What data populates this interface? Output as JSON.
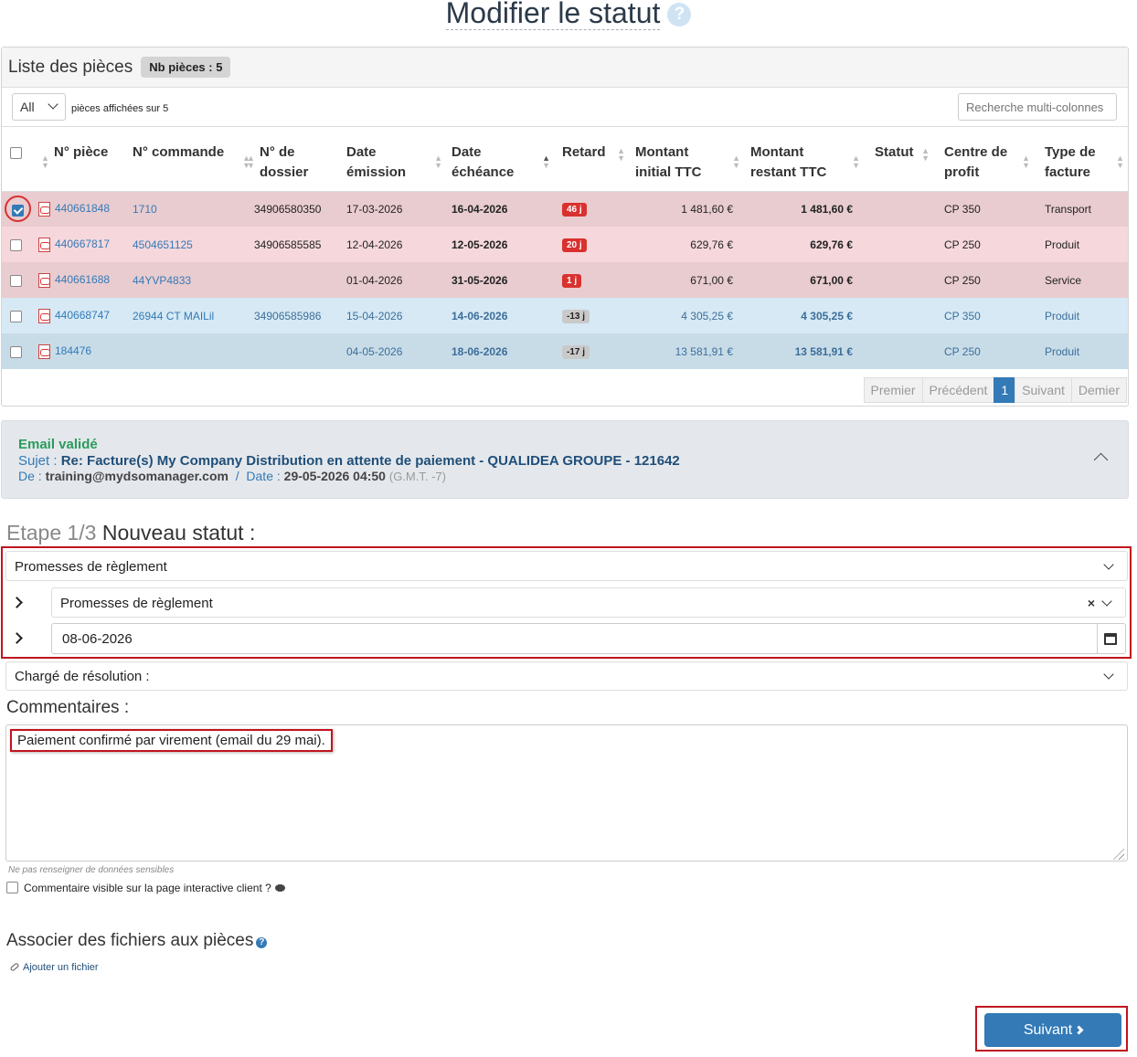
{
  "page": {
    "title": "Modifier le statut",
    "help_glyph": "?"
  },
  "panel": {
    "title": "Liste des pièces",
    "count_badge": "Nb pièces : 5",
    "page_size": "All",
    "shown_text": "pièces affichées sur 5",
    "search_placeholder": "Recherche multi-colonnes"
  },
  "columns": [
    "N° pièce",
    "N° commande",
    "N° de dossier",
    "Date émission",
    "Date échéance",
    "Retard",
    "Montant initial TTC",
    "Montant restant TTC",
    "Statut",
    "Centre de profit",
    "Type de facture"
  ],
  "rows": [
    {
      "piece": "440661848",
      "commande": "1710",
      "dossier": "34906580350",
      "emission": "17-03-2026",
      "echeance": "16-04-2026",
      "retard": "46 j",
      "retard_kind": "red",
      "initial": "1 481,60 €",
      "restant": "1 481,60 €",
      "statut": "",
      "centre": "CP 350",
      "type": "Transport",
      "checked": true
    },
    {
      "piece": "440667817",
      "commande": "4504651125",
      "dossier": "34906585585",
      "emission": "12-04-2026",
      "echeance": "12-05-2026",
      "retard": "20 j",
      "retard_kind": "red",
      "initial": "629,76 €",
      "restant": "629,76 €",
      "statut": "",
      "centre": "CP 250",
      "type": "Produit",
      "checked": false
    },
    {
      "piece": "440661688",
      "commande": "44YVP4833",
      "dossier": "",
      "emission": "01-04-2026",
      "echeance": "31-05-2026",
      "retard": "1 j",
      "retard_kind": "red",
      "initial": "671,00 €",
      "restant": "671,00 €",
      "statut": "",
      "centre": "CP 250",
      "type": "Service",
      "checked": false
    },
    {
      "piece": "440668747",
      "commande": "26944 CT MAILil",
      "dossier": "34906585986",
      "emission": "15-04-2026",
      "echeance": "14-06-2026",
      "retard": "-13 j",
      "retard_kind": "grey",
      "initial": "4 305,25 €",
      "restant": "4 305,25 €",
      "statut": "",
      "centre": "CP 350",
      "type": "Produit",
      "checked": false
    },
    {
      "piece": "184476",
      "commande": "",
      "dossier": "",
      "emission": "04-05-2026",
      "echeance": "18-06-2026",
      "retard": "-17 j",
      "retard_kind": "grey",
      "initial": "13 581,91 €",
      "restant": "13 581,91 €",
      "statut": "",
      "centre": "CP 250",
      "type": "Produit",
      "checked": false
    }
  ],
  "pager": {
    "first": "Premier",
    "prev": "Précédent",
    "current": "1",
    "next": "Suivant",
    "last": "Demier"
  },
  "email": {
    "status": "Email validé",
    "subject_label": "Sujet :",
    "subject": "Re: Facture(s) My Company Distribution en attente de paiement - QUALIDEA GROUPE - 121642",
    "from_label": "De :",
    "from": "training@mydsomanager.com",
    "sep": "/",
    "date_label": "Date :",
    "date": "29-05-2026 04:50",
    "tz": "(G.M.T. -7)"
  },
  "step": {
    "number": "Etape 1/3",
    "title": "Nouveau statut :"
  },
  "status_form": {
    "status": "Promesses de règlement",
    "sub_status": "Promesses de règlement",
    "date": "08-06-2026",
    "owner": "Chargé de résolution :"
  },
  "comments": {
    "label": "Commentaires :",
    "text": "Paiement confirmé par virement (email du 29 mai).",
    "hint": "Ne pas renseigner de données sensibles",
    "visible_label": "Commentaire visible sur la page interactive client ?"
  },
  "files": {
    "title": "Associer des fichiers aux pièces",
    "add": "Ajouter un fichier"
  },
  "next_button": "Suivant"
}
